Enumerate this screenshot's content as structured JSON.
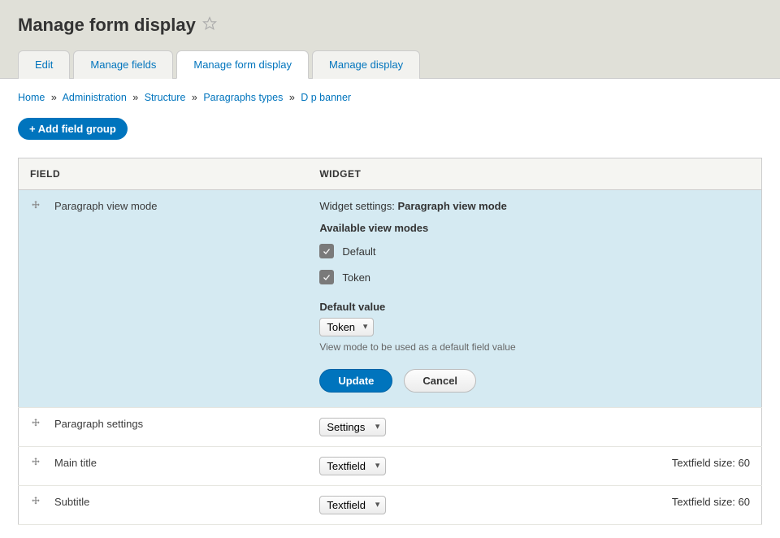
{
  "page_title": "Manage form display",
  "tabs": [
    {
      "label": "Edit",
      "active": false
    },
    {
      "label": "Manage fields",
      "active": false
    },
    {
      "label": "Manage form display",
      "active": true
    },
    {
      "label": "Manage display",
      "active": false
    }
  ],
  "breadcrumb": {
    "items": [
      "Home",
      "Administration",
      "Structure",
      "Paragraphs types",
      "D p banner"
    ],
    "sep": "»"
  },
  "add_field_group_label": "+ Add field group",
  "table": {
    "headers": {
      "field": "FIELD",
      "widget": "WIDGET"
    },
    "rows": [
      {
        "field_label": "Paragraph view mode",
        "editing": true,
        "widget_settings": {
          "prefix": "Widget settings: ",
          "name": "Paragraph view mode",
          "available_heading": "Available view modes",
          "checkboxes": [
            {
              "label": "Default",
              "checked": true
            },
            {
              "label": "Token",
              "checked": true
            }
          ],
          "default_value_label": "Default value",
          "default_value_selected": "Token",
          "hint": "View mode to be used as a default field value",
          "update_label": "Update",
          "cancel_label": "Cancel"
        }
      },
      {
        "field_label": "Paragraph settings",
        "widget_select": "Settings",
        "summary": ""
      },
      {
        "field_label": "Main title",
        "widget_select": "Textfield",
        "summary": "Textfield size: 60"
      },
      {
        "field_label": "Subtitle",
        "widget_select": "Textfield",
        "summary": "Textfield size: 60"
      }
    ]
  }
}
